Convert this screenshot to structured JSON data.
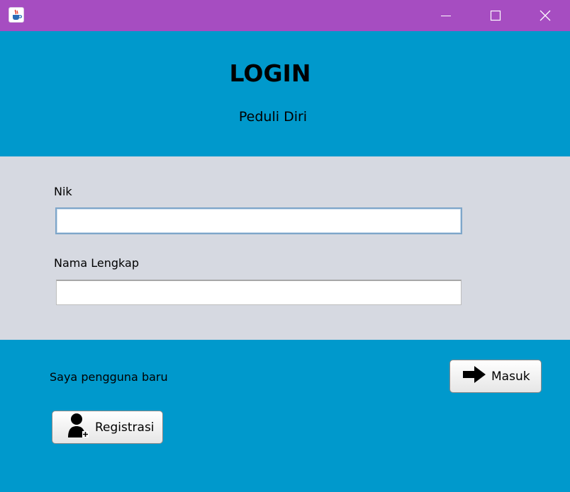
{
  "window": {
    "icon": "java-cup-icon",
    "controls": [
      "minimize",
      "maximize",
      "close"
    ]
  },
  "header": {
    "title": "LOGIN",
    "subtitle": "Peduli Diri"
  },
  "form": {
    "nik_label": "Nik",
    "nik_value": "",
    "nama_label": "Nama Lengkap",
    "nama_value": ""
  },
  "footer": {
    "new_user_text": "Saya pengguna baru",
    "login_button": "Masuk",
    "login_icon": "arrow-right-icon",
    "register_button": "Registrasi",
    "register_icon": "add-user-icon"
  },
  "colors": {
    "titlebar": "#a64dc1",
    "panel_blue": "#0099cc",
    "form_gray": "#d6d9e1"
  }
}
